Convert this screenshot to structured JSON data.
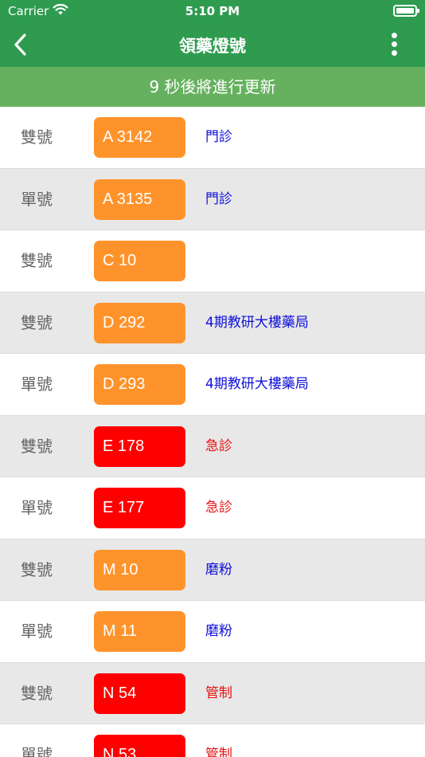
{
  "status_bar": {
    "carrier": "Carrier",
    "time": "5:10 PM"
  },
  "nav": {
    "title": "領藥燈號"
  },
  "banner": {
    "text": "9 秒後將進行更新"
  },
  "rows": [
    {
      "parity": "雙號",
      "number": "A 3142",
      "location": "門診",
      "badge_color": "#ff932b",
      "location_color": "#1010d8"
    },
    {
      "parity": "單號",
      "number": "A 3135",
      "location": "門診",
      "badge_color": "#ff932b",
      "location_color": "#1010d8"
    },
    {
      "parity": "雙號",
      "number": "C 10",
      "location": "",
      "badge_color": "#ff932b",
      "location_color": "#1010d8"
    },
    {
      "parity": "雙號",
      "number": "D 292",
      "location": "4期教研大樓藥局",
      "badge_color": "#ff932b",
      "location_color": "#1010d8"
    },
    {
      "parity": "單號",
      "number": "D 293",
      "location": "4期教研大樓藥局",
      "badge_color": "#ff932b",
      "location_color": "#1010d8"
    },
    {
      "parity": "雙號",
      "number": "E 178",
      "location": "急診",
      "badge_color": "#ff0000",
      "location_color": "#e81010"
    },
    {
      "parity": "單號",
      "number": "E 177",
      "location": "急診",
      "badge_color": "#ff0000",
      "location_color": "#e81010"
    },
    {
      "parity": "雙號",
      "number": "M 10",
      "location": "磨粉",
      "badge_color": "#ff932b",
      "location_color": "#1010d8"
    },
    {
      "parity": "單號",
      "number": "M 11",
      "location": "磨粉",
      "badge_color": "#ff932b",
      "location_color": "#1010d8"
    },
    {
      "parity": "雙號",
      "number": "N 54",
      "location": "管制",
      "badge_color": "#ff0000",
      "location_color": "#e81010"
    },
    {
      "parity": "單號",
      "number": "N 53",
      "location": "管制",
      "badge_color": "#ff0000",
      "location_color": "#e81010"
    }
  ],
  "colors": {
    "header_green": "#2e9b4f",
    "banner_green": "#66b15f",
    "row_alt": "#e8e8e8"
  },
  "icons": {
    "back": "chevron-left-icon",
    "menu": "more-vertical-icon",
    "wifi": "wifi-icon",
    "battery": "battery-icon"
  }
}
